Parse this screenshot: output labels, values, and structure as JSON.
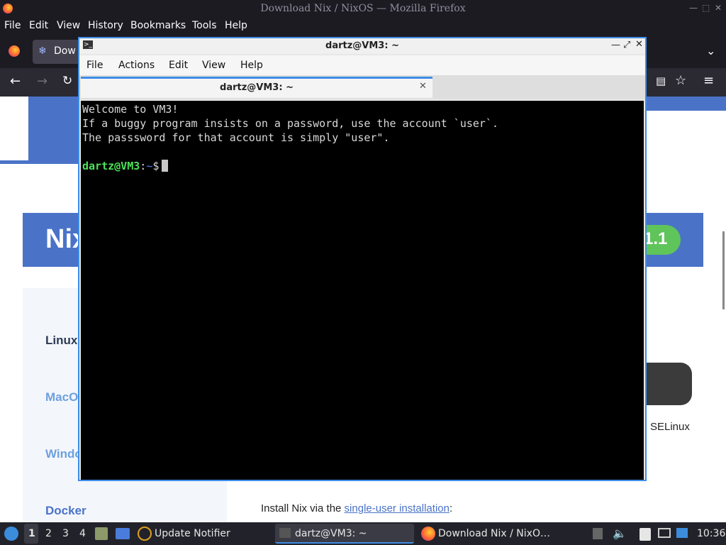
{
  "firefox": {
    "window_title": "Download Nix / NixOS — Mozilla Firefox",
    "menu": [
      "File",
      "Edit",
      "View",
      "History",
      "Bookmarks",
      "Tools",
      "Help"
    ],
    "tab_title": "Dow"
  },
  "page": {
    "banner_title": "Nix",
    "version_badge": "1.1",
    "sidebar": [
      "Linux",
      "MacO",
      "Windo",
      "Docker"
    ],
    "selinux": "SELinux",
    "install_prefix": "Install Nix via the ",
    "install_link": "single-user installation",
    "install_suffix": ":"
  },
  "terminal": {
    "window_title": "dartz@VM3: ~",
    "menu": [
      "File",
      "Actions",
      "Edit",
      "View",
      "Help"
    ],
    "tab_title": "dartz@VM3: ~",
    "lines": [
      "Welcome to VM3!",
      "If a buggy program insists on a password, use the account `user`.",
      "The passsword for that account is simply \"user\"."
    ],
    "prompt_user": "dartz@VM3",
    "prompt_sep": ":",
    "prompt_path": "~",
    "prompt_sym": "$"
  },
  "taskbar": {
    "workspaces": [
      "1",
      "2",
      "3",
      "4"
    ],
    "tasks": [
      "Update Notifier",
      "dartz@VM3: ~",
      "Download Nix / NixO…"
    ],
    "clock": "10:36"
  },
  "colors": {
    "accent": "#3e8de6",
    "prompt_green": "#4ee35a",
    "prompt_blue": "#4a7cf7",
    "nix_blue": "#4a73c8"
  }
}
